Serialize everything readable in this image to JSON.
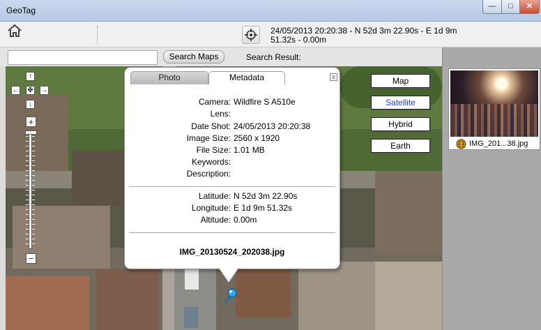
{
  "window": {
    "title": "GeoTag",
    "min_label": "—",
    "max_label": "□",
    "close_label": "✕"
  },
  "toolbar": {
    "home_icon": "home-icon",
    "locate_icon": "crosshair-icon",
    "coords_text": "24/05/2013 20:20:38 - N 52d 3m 22.90s - E 1d 9m 51.32s - 0.00m"
  },
  "search": {
    "value": "",
    "placeholder": "",
    "button_label": "Search Maps",
    "result_label": "Search Result:"
  },
  "map_controls": {
    "pan_up": "↑",
    "pan_left": "←",
    "pan_center": "✤",
    "pan_right": "→",
    "pan_down": "↓",
    "zoom_in": "+",
    "zoom_out": "−"
  },
  "map_types": [
    {
      "label": "Map",
      "active": false
    },
    {
      "label": "Satellite",
      "active": true
    },
    {
      "label": "Hybrid",
      "active": false
    },
    {
      "label": "Earth",
      "active": false
    }
  ],
  "popup": {
    "tabs": [
      "Photo",
      "Metadata"
    ],
    "active_tab": "Metadata",
    "close_label": "x",
    "camera_fields": [
      {
        "label": "Camera:",
        "value": "Wildfire S A510e"
      },
      {
        "label": "Lens:",
        "value": ""
      },
      {
        "label": "Date Shot:",
        "value": "24/05/2013 20:20:38"
      },
      {
        "label": "Image Size:",
        "value": "2560 x 1920"
      },
      {
        "label": "File Size:",
        "value": "1.01 MB"
      },
      {
        "label": "Keywords:",
        "value": ""
      },
      {
        "label": "Description:",
        "value": ""
      }
    ],
    "geo_fields": [
      {
        "label": "Latitude:",
        "value": "N 52d 3m 22.90s"
      },
      {
        "label": "Longitude:",
        "value": "E 1d 9m 51.32s"
      },
      {
        "label": "Altitude:",
        "value": "0.00m"
      }
    ],
    "filename": "IMG_20130524_202038.jpg"
  },
  "thumbnail": {
    "label": "IMG_201...38.jpg",
    "icon": "globe-icon"
  },
  "colors": {
    "accent_active": "#1a3fd0",
    "titlebar": "#c9d9ee",
    "panel": "#a9a9a9"
  }
}
